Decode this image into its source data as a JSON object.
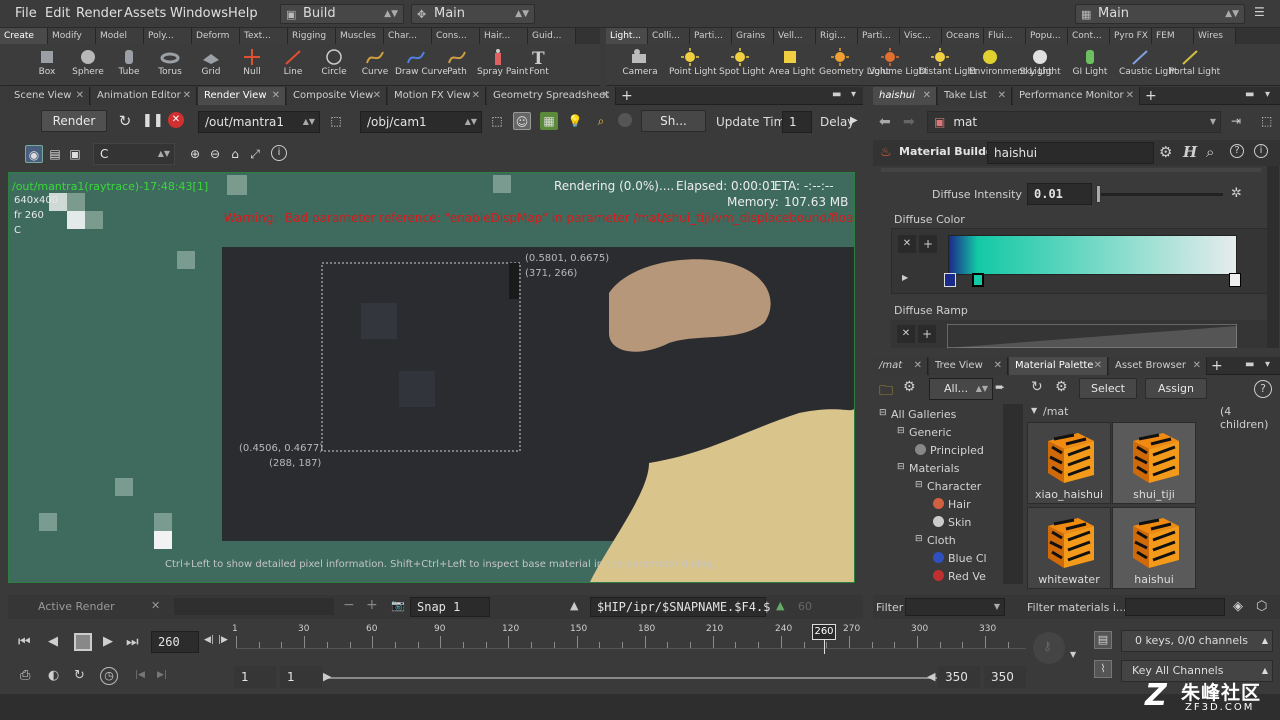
{
  "menubar": {
    "items": [
      "File",
      "Edit",
      "Render",
      "Assets",
      "Windows",
      "Help"
    ],
    "desktop": "Build",
    "context": "Main",
    "workspace": "Main"
  },
  "shelf_left": {
    "tabs": [
      "Create",
      "Modify",
      "Model",
      "Poly...",
      "Deform",
      "Text...",
      "Rigging",
      "Muscles",
      "Char...",
      "Cons...",
      "Hair...",
      "Guid..."
    ],
    "tools": [
      "Box",
      "Sphere",
      "Tube",
      "Torus",
      "Grid",
      "Null",
      "Line",
      "Circle",
      "Curve",
      "Draw Curve",
      "Path",
      "Spray Paint",
      "Font"
    ]
  },
  "shelf_right": {
    "tabs": [
      "Light...",
      "Colli...",
      "Parti...",
      "Grains",
      "Vell...",
      "Rigi...",
      "Parti...",
      "Visc...",
      "Oceans",
      "Flui...",
      "Popu...",
      "Cont...",
      "Pyro FX",
      "FEM",
      "Wires"
    ],
    "tools": [
      "Camera",
      "Point Light",
      "Spot Light",
      "Area Light",
      "Geometry Light",
      "Volume Light",
      "Distant Light",
      "Environment Light",
      "Sky Light",
      "GI Light",
      "Caustic Light",
      "Portal Light"
    ]
  },
  "left_pane": {
    "tabs": [
      "Scene View",
      "Animation Editor",
      "Render View",
      "Composite View",
      "Motion FX View",
      "Geometry Spreadsheet"
    ],
    "render_button": "Render",
    "rop_path": "/out/mantra1",
    "cam_path": "/obj/cam1",
    "sh_label": "Sh...",
    "update_time_label": "Update Time",
    "update_time_value": "1",
    "delay_label": "Delay",
    "channel": "C"
  },
  "viewport": {
    "status_left": "/out/mantra1(raytrace)-17:48:43[1]",
    "resolution": "640x400",
    "frame": "fr 260",
    "channel_short": "C",
    "rendering": "Rendering (0.0%)....",
    "elapsed": "Elapsed: 0:00:01",
    "eta": "ETA: -:--:--",
    "memory": "Memory:",
    "memory_value": "107.63 MB",
    "warning_label": "Warning:",
    "warning_text": "Bad parameter reference: \"enableDispMap\" in parameter /mat/shui_tiji/vm_displacebound/floatdef.",
    "coord_tr_uv": "(0.5801, 0.6675)",
    "coord_tr_px": "(371, 266)",
    "coord_bl_uv": "(0.4506, 0.4677)",
    "coord_bl_px": "(288, 187)",
    "hint": "Ctrl+Left to show detailed pixel information. Shift+Ctrl+Left to inspect base material in the parameter dialog."
  },
  "render_bottom": {
    "active_render": "Active Render",
    "snap": "Snap 1",
    "snapname": "$HIP/ipr/$SNAPNAME.$F4.$",
    "sixty": "60"
  },
  "param_pane": {
    "tabs": [
      "haishui",
      "Take List",
      "Performance Monitor"
    ],
    "path": "mat",
    "node_type": "Material Builder",
    "node_name": "haishui",
    "diffuse_intensity_label": "Diffuse Intensity",
    "diffuse_intensity_value": "0.01",
    "diffuse_intensity_fraction": 0.01,
    "diffuse_color_label": "Diffuse Color",
    "diffuse_ramp_label": "Diffuse Ramp",
    "ramp_start": "#1a2a8a",
    "ramp_mid": "#14c9a6",
    "ramp_end": "#e6ecec"
  },
  "palette_pane": {
    "tabs": [
      "/mat",
      "Tree View",
      "Material Palette",
      "Asset Browser"
    ],
    "filter_all": "All...",
    "select_button": "Select",
    "assign_button": "Assign",
    "tree": [
      {
        "label": "All Galleries",
        "level": 0
      },
      {
        "label": "Generic",
        "level": 1
      },
      {
        "label": "Principled",
        "level": 2
      },
      {
        "label": "Materials",
        "level": 1
      },
      {
        "label": "Character",
        "level": 2
      },
      {
        "label": "Hair",
        "level": 3
      },
      {
        "label": "Skin",
        "level": 3
      },
      {
        "label": "Cloth",
        "level": 2
      },
      {
        "label": "Blue Cl",
        "level": 3
      },
      {
        "label": "Red Ve",
        "level": 3
      }
    ],
    "mat_path": "/mat",
    "children": "(4 children)",
    "materials": [
      "xiao_haishui",
      "shui_tiji",
      "whitewater",
      "haishui"
    ],
    "filter_label": "Filter",
    "filter_materials": "Filter materials i..."
  },
  "timeline": {
    "frame": "260",
    "current_marker": "260",
    "ticks": [
      "1",
      "30",
      "60",
      "90",
      "120",
      "150",
      "180",
      "210",
      "240",
      "270",
      "300",
      "330"
    ],
    "keys_info": "0 keys, 0/0 channels",
    "key_all": "Key All Channels",
    "range_start": "1",
    "range_start2": "1",
    "range_end": "350",
    "range_end2": "350"
  },
  "watermark": {
    "cn": "朱峰社区",
    "en": "ZF3D.COM"
  }
}
